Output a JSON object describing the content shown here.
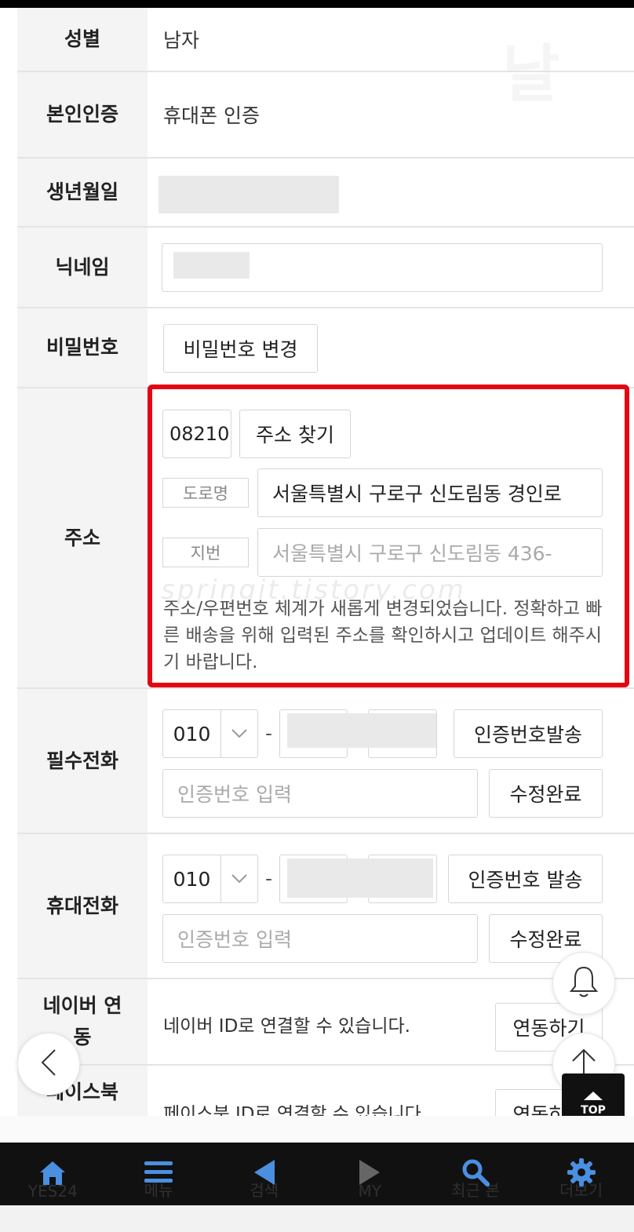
{
  "rows": {
    "gender": {
      "label": "성별",
      "value": "남자"
    },
    "verification": {
      "label": "본인인증",
      "value": "휴대폰 인증"
    },
    "birthdate": {
      "label": "생년월일"
    },
    "nickname": {
      "label": "닉네임"
    },
    "password": {
      "label": "비밀번호",
      "button": "비밀번호 변경"
    },
    "address": {
      "label": "주소",
      "zipcode": "08210",
      "search_button": "주소 찾기",
      "road_tag": "도로명",
      "road_value": "서울특별시 구로구 신도림동 경인로",
      "jibun_tag": "지번",
      "jibun_value": "서울특별시 구로구 신도림동 436-",
      "notice": "주소/우편번호 체계가 새롭게 변경되었습니다. 정확하고 빠른 배송을 위해 입력된 주소를 확인하시고 업데이트 해주시기 바랍니다."
    },
    "required_phone": {
      "label": "필수전화",
      "prefix": "010",
      "send_button": "인증번호발송",
      "code_placeholder": "인증번호 입력",
      "confirm_button": "수정완료"
    },
    "mobile_phone": {
      "label": "휴대전화",
      "prefix": "010",
      "send_button": "인증번호 발송",
      "code_placeholder": "인증번호 입력",
      "confirm_button": "수정완료"
    },
    "naver": {
      "label": "네이버 연동",
      "text": "네이버 ID로 연결할 수 있습니다.",
      "button": "연동하기"
    },
    "facebook": {
      "label": "페이스북",
      "text": "페이스북 ID로 연결할 수 있습니다.",
      "button": "연동하기"
    }
  },
  "watermark": "springit.tistory.com",
  "top_button": "TOP",
  "highlight_color": "#e30613",
  "ghost_nav": [
    "YES24",
    "메뉴",
    "검색",
    "MY",
    "최근 본",
    "더보기"
  ],
  "navbar_icons": [
    "home-icon",
    "menu-icon",
    "back-icon",
    "forward-icon",
    "search-icon",
    "settings-icon"
  ],
  "nav_icon_color": "#4a8fe0"
}
